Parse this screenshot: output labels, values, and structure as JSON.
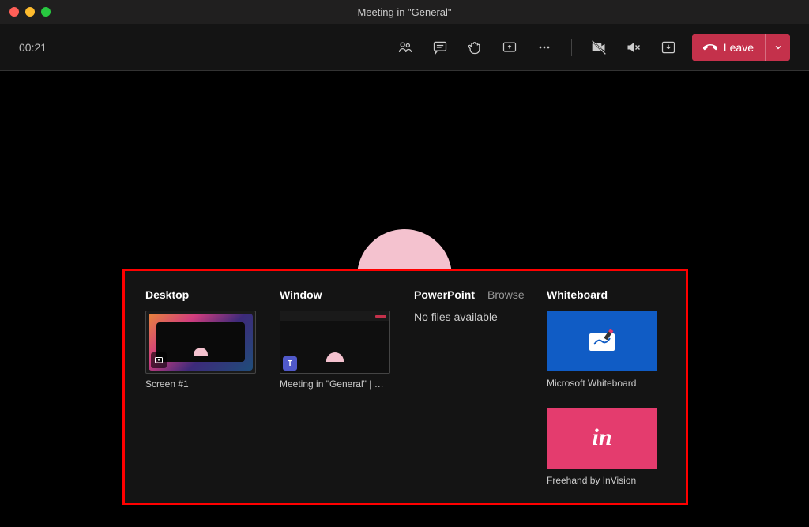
{
  "window": {
    "title": "Meeting in \"General\""
  },
  "toolbar": {
    "timer": "00:21",
    "leave_label": "Leave"
  },
  "share": {
    "desktop": {
      "header": "Desktop",
      "item_label": "Screen #1"
    },
    "window": {
      "header": "Window",
      "item_label": "Meeting in \"General\" | M…"
    },
    "powerpoint": {
      "header": "PowerPoint",
      "browse": "Browse",
      "empty": "No files available"
    },
    "whiteboard": {
      "header": "Whiteboard",
      "ms_label": "Microsoft Whiteboard",
      "invision_label": "Freehand by InVision"
    }
  },
  "colors": {
    "accent": "#c4314b",
    "highlight_box": "#ff0000"
  }
}
